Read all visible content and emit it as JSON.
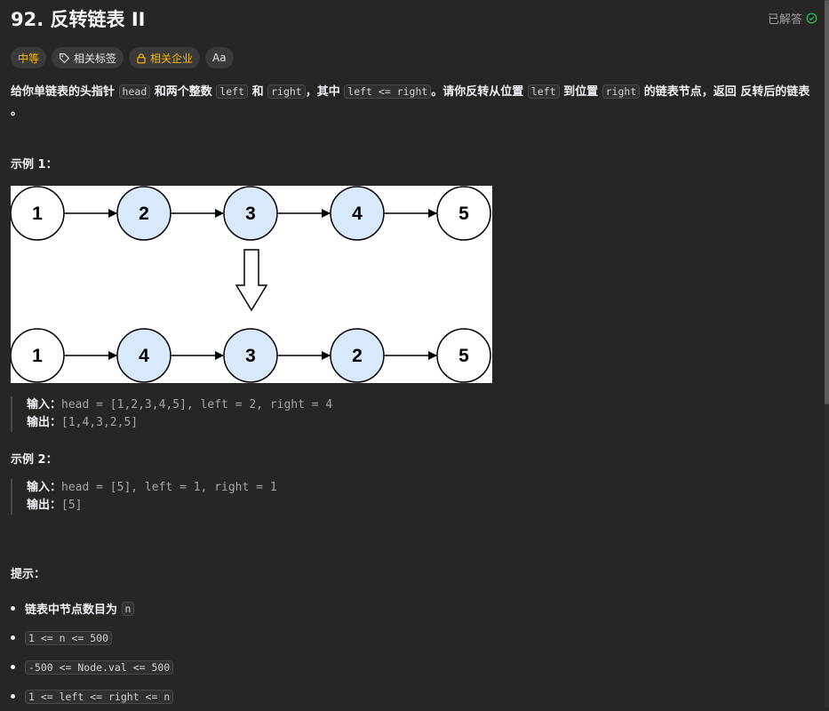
{
  "problem": {
    "title": "92. 反转链表 II",
    "status": "已解答",
    "tags": {
      "difficulty": "中等",
      "topics": "相关标签",
      "companies": "相关企业",
      "font_icon": "Aa"
    },
    "description": {
      "p1": "给你单链表的头指针",
      "c1": "head",
      "p2": "和两个整数",
      "c2": "left",
      "p3": "和",
      "c3": "right",
      "p4": "，其中",
      "c4": "left <= right",
      "p5": "。请你反转从位置",
      "c5": "left",
      "p6": "到位置",
      "c6": "right",
      "p7": "的链表节点，返回",
      "p8": "反转后的链表",
      "p9": "。"
    }
  },
  "example1": {
    "heading": "示例 1：",
    "diagram": {
      "top_nodes": [
        "1",
        "2",
        "3",
        "4",
        "5"
      ],
      "bottom_nodes": [
        "1",
        "4",
        "3",
        "2",
        "5"
      ],
      "highlight_color": "#dae8fc"
    },
    "input_label": "输入：",
    "input": "head = [1,2,3,4,5], left = 2, right = 4",
    "output_label": "输出：",
    "output": "[1,4,3,2,5]"
  },
  "example2": {
    "heading": "示例 2：",
    "input_label": "输入：",
    "input": "head = [5], left = 1, right = 1",
    "output_label": "输出：",
    "output": "[5]"
  },
  "hints": {
    "heading": "提示：",
    "item1_text": "链表中节点数目为",
    "item1_code": "n",
    "item2_code": "1 <= n <= 500",
    "item3_code": "-500 <= Node.val <= 500",
    "item4_code": "1 <= left <= right <= n"
  },
  "colors": {
    "background": "#262626",
    "difficulty": "#ffb800",
    "solved_check": "#2cbb5d"
  }
}
